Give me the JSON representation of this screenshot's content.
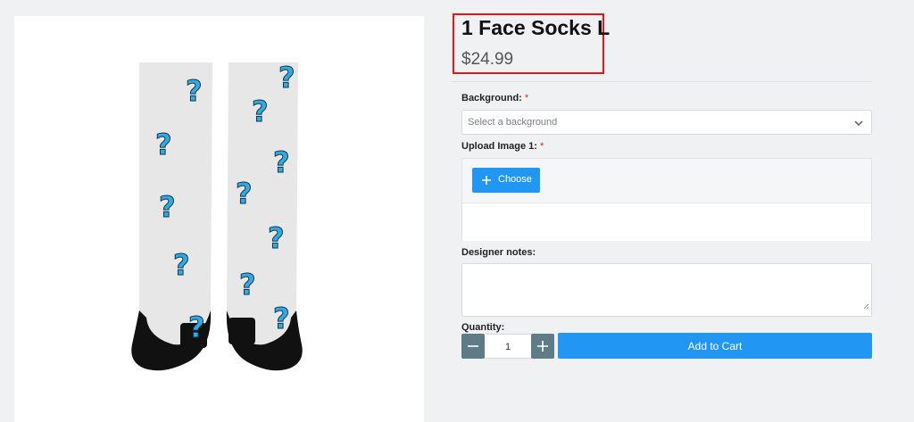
{
  "product": {
    "title": "1 Face Socks L",
    "price": "$24.99",
    "image_icon": "socks-product-image"
  },
  "form": {
    "background": {
      "label": "Background:",
      "required_mark": "*",
      "placeholder": "Select a background",
      "icon": "chevron-down-icon"
    },
    "upload": {
      "label": "Upload Image 1:",
      "required_mark": "*",
      "button_label": "Choose",
      "button_icon": "plus-icon"
    },
    "notes": {
      "label": "Designer notes:",
      "value": ""
    },
    "quantity": {
      "label": "Quantity:",
      "value": "1",
      "minus_icon": "minus-icon",
      "plus_icon": "plus-icon"
    },
    "add_to_cart_label": "Add to Cart"
  },
  "colors": {
    "accent": "#2196f3",
    "highlight_border": "#e8141c",
    "stepper": "#5f7b85",
    "required": "#e02424"
  }
}
